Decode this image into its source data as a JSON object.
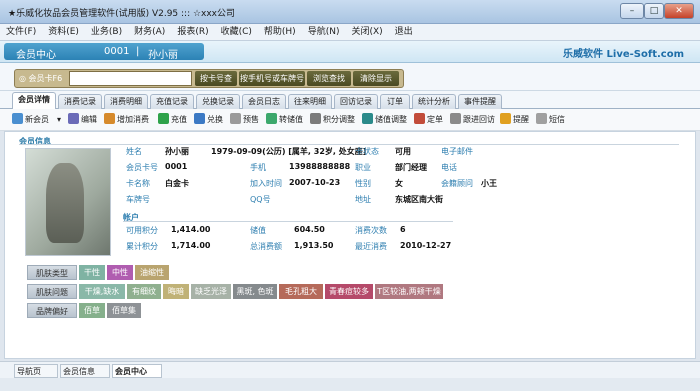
{
  "window": {
    "title": "★乐威化妆品会员管理软件(试用版) V2.95 ::: ☆xxx公司",
    "min": "–",
    "max": "□",
    "close": "✕"
  },
  "menu": [
    "文件(F)",
    "资料(E)",
    "业务(B)",
    "财务(A)",
    "报表(R)",
    "收藏(C)",
    "帮助(H)",
    "导航(N)",
    "关闭(X)",
    "退出"
  ],
  "banner": {
    "section": "会员中心",
    "card_no": "0001",
    "sep": "|",
    "member_name": "孙小丽",
    "brand": "乐威软件 Live-Soft.com"
  },
  "search": {
    "label": "◎ 会员卡F6",
    "placeholder": "",
    "buttons": [
      "按卡号查",
      "按手机号或车牌号",
      "浏览查找",
      "清除显示"
    ]
  },
  "tabs": [
    "会员详情",
    "消费记录",
    "消费明细",
    "充值记录",
    "兑换记录",
    "会员日志",
    "往来明细",
    "回访记录",
    "订单",
    "统计分析",
    "事件提醒"
  ],
  "toolbar": [
    {
      "label": "新会员",
      "icon": "person-add-icon",
      "color": "#4a8fd0"
    },
    {
      "label": "▾",
      "icon": "",
      "color": ""
    },
    {
      "label": "编辑",
      "icon": "edit-icon",
      "color": "#6b6bb8"
    },
    {
      "label": "增加消费",
      "icon": "add-consume-icon",
      "color": "#d68a2c"
    },
    {
      "label": "充值",
      "icon": "recharge-icon",
      "color": "#2ea24a"
    },
    {
      "label": "兑换",
      "icon": "exchange-icon",
      "color": "#3b79c4"
    },
    {
      "label": "预售",
      "icon": "presale-icon",
      "color": "#9a9a9a"
    },
    {
      "label": "转储值",
      "icon": "transfer-icon",
      "color": "#3ca86c"
    },
    {
      "label": "积分调整",
      "icon": "points-icon",
      "color": "#7b7b7b"
    },
    {
      "label": "储值调整",
      "icon": "balance-icon",
      "color": "#2a8a8a"
    },
    {
      "label": "定单",
      "icon": "order-icon",
      "color": "#c24c3a"
    },
    {
      "label": "跟进回访",
      "icon": "followup-icon",
      "color": "#8a8a8a"
    },
    {
      "label": "提醒",
      "icon": "alarm-icon",
      "color": "#e0a020"
    },
    {
      "label": "短信",
      "icon": "sms-icon",
      "color": "#a0a0a0"
    }
  ],
  "info": {
    "section_title": "会员信息",
    "name_label": "姓名",
    "name": "孙小丽",
    "birthday": "1979-09-09(公历) [属羊, 32岁, 处女座]",
    "card_status_label": "卡状态",
    "card_status": "可用",
    "email_label": "电子邮件",
    "email": "",
    "card_no_label": "会员卡号",
    "card_no": "0001",
    "mobile_label": "手机",
    "mobile": "13988888888",
    "job_label": "职业",
    "job": "部门经理",
    "phone_label": "电话",
    "phone": "",
    "card_name_label": "卡名称",
    "card_name": "白金卡",
    "join_label": "加入时间",
    "join": "2007-10-23",
    "gender_label": "性别",
    "gender": "女",
    "advisor_label": "会籍顾问",
    "advisor": "小王",
    "plate_label": "车牌号",
    "plate": "",
    "qq_label": "QQ号",
    "qq": "",
    "address_label": "地址",
    "address": "东城区南大街"
  },
  "account": {
    "section_title": "帐户",
    "points_label": "可用积分",
    "points": "1,414.00",
    "stored_label": "储值",
    "stored": "604.50",
    "visits_label": "消费次数",
    "visits": "6",
    "total_points_label": "累计积分",
    "total_points": "1,714.00",
    "total_spend_label": "总消费额",
    "total_spend": "1,913.50",
    "last_visit_label": "最近消费",
    "last_visit": "2010-12-27"
  },
  "tags": {
    "skin_type": {
      "label": "肌肤类型",
      "items": [
        {
          "text": "干性",
          "color": "#7fb3a3"
        },
        {
          "text": "中性",
          "color": "#b05db0"
        },
        {
          "text": "油缩性",
          "color": "#b9a46f"
        }
      ]
    },
    "skin_problem": {
      "label": "肌肤问题",
      "items": [
        {
          "text": "干燥,缺水",
          "color": "#8ab8a8"
        },
        {
          "text": "有细纹",
          "color": "#8fb08f"
        },
        {
          "text": "晦暗",
          "color": "#c0b277"
        },
        {
          "text": "缺乏光泽",
          "color": "#a7b2a7"
        },
        {
          "text": "黑斑, 色斑",
          "color": "#858a8d"
        },
        {
          "text": "毛孔粗大",
          "color": "#b56a5a"
        },
        {
          "text": "青春痘较多",
          "color": "#b54a6a"
        },
        {
          "text": "T区较油,两颊干燥",
          "color": "#b07880"
        }
      ]
    },
    "brand_pref": {
      "label": "品牌偏好",
      "items": [
        {
          "text": "佰草",
          "color": "#86b08c"
        },
        {
          "text": "佰草集",
          "color": "#8e9296"
        }
      ]
    }
  },
  "status_tabs": [
    "导航页",
    "会员信息",
    "会员中心"
  ]
}
